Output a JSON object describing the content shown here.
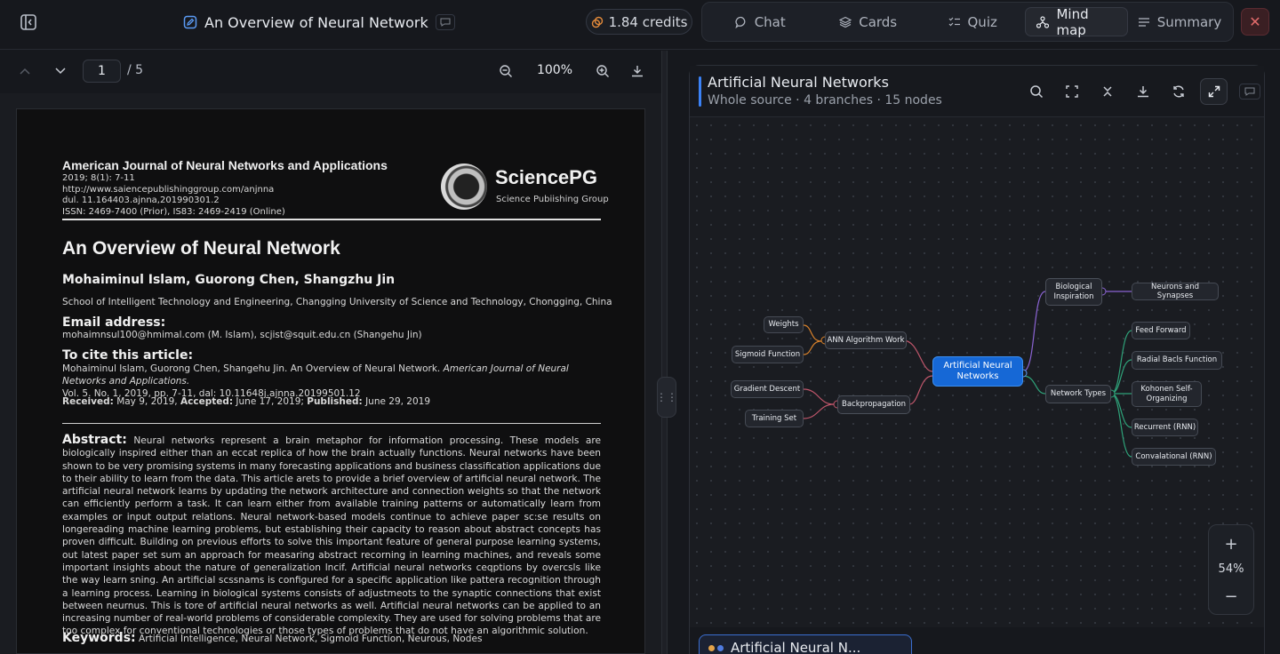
{
  "topbar": {
    "doc_title": "An Overview of Neural Network",
    "credits": "1.84 credits",
    "tabs": [
      {
        "label": "Chat",
        "icon": "chat-bubble-icon"
      },
      {
        "label": "Cards",
        "icon": "cards-stack-icon"
      },
      {
        "label": "Quiz",
        "icon": "quiz-list-icon"
      },
      {
        "label": "Mind map",
        "icon": "mind-map-icon",
        "active": true
      },
      {
        "label": "Summary",
        "icon": "summary-lines-icon"
      }
    ]
  },
  "pdf": {
    "current_page": "1",
    "page_total": "/ 5",
    "zoom": "100%",
    "journal": "American Journal of Neural Networks and Applications",
    "journal_meta": [
      "2019; 8(1): 7-11",
      "http://www.saiencepublishinggroup.com/anjnna",
      "dul. 11.164403.ajnna,201990301.2",
      "ISSN: 2469-7400 (Prior), IS83: 2469-2419 (Online)"
    ],
    "publisher": "SciencePG",
    "publisher_sub": "Science Pubiishing Group",
    "title": "An Overview of Neural Network",
    "authors": "Mohaiminul Islam, Guorong Chen, Shangzhu Jin",
    "affiliation": "School of Intelligent Technology and Engineering, Changging University of Science and Technology, Chongging, China",
    "email_heading": "Email address:",
    "email": "mohaimnsul100@hmimal.com (M. Islam), scjist@squit.edu.cn (Shangehu Jin)",
    "cite_heading": "To cite this article:",
    "cite_text": "Mohaiminul Islam, Guorong Chen, Shangehu Jin. An Overview of Neural Network.",
    "cite_journal": "American Journal of Neural Networks and Applications.",
    "cite_rest": "Vol. 5. No. 1, 2019, pp. 7-11, dal: 10.11648j.ajnna.20199501.12",
    "received_label": "Received:",
    "received": "May 9, 2019,",
    "accepted_label": "Accepted:",
    "accepted": "June 17, 2019;",
    "published_label": "Published:",
    "published": "June 29, 2019",
    "abstract_heading": "Abstract:",
    "abstract": "Neural networks represent a brain metaphor for information processing. These models are biologically inspired either than an eccat replica of how the brain actually functions. Neural networks have been shown to be very promising systems in many forecasting applications and business classification applications due to their ability to learn from the data. This article arets to provide a brief overview of artificial neural network. The artificial neural network learns by updating the network architecture and connection weights so that the network can efficiently perform a task. It can learn either from available training patterns or automatically learn from examples or input output relations. Neural network-based models continue to achieve paper sc:se results on longereading machine learning problems, but establishing their capacity to reason about abstract concepts has proven difficult. Building on previous efforts to solve this important feature of general purpose learning systems, out latest paper set sum an approach for measaring abstract recorning in learning machines, and reveals some important insights about the nature of generalization lncif. Artificial neural networks ceqptions by overcsls like the way learn sning. An artificial scssnams is configured for a specific application like pattera recognition through a learning process. Learning in biological systems consists of adjustmeots to the synaptic connections that exist between neurnus. This is tore of artificial neural networks as well. Artificial neural networks can be applied to an increasing number of real-world problems of considerable complexity. They are used for solving problems that are too complex for conventional technologies or those types of problems that do not have an algorithmic solution.",
    "keywords_heading": "Keywords:",
    "keywords": "Artificial Intelligence, Neural Network, Sigmoid Function, Neurous, Nodes"
  },
  "mindmap": {
    "title": "Artificial Neural Networks",
    "subtitle": "Whole source · 4 branches · 15 nodes",
    "zoom": "54%",
    "bottom_chip": "Artificial Neural N...",
    "root": "Artificial Neural Networks",
    "branches": {
      "ann": "ANN Algorithm Work",
      "backprop": "Backpropagation",
      "bio": "Biological Inspiration",
      "types": "Network Types"
    },
    "leaves": {
      "weights": "Weights",
      "sigmoid": "Sigmoid Function",
      "gradient": "Gradient Descent",
      "training": "Training Set",
      "neurons": "Neurons and Synapses",
      "feedforward": "Feed Forward",
      "rbf": "Radial Bacls Function",
      "kohonen": "Kohonen Self-Organizing",
      "recurrent": "Recurrent (RNN)",
      "conv": "Convalational (RNN)"
    },
    "colors": {
      "root": "#1668d6",
      "left_links": "#c0566b",
      "ann_links": "#d9822b",
      "bio_links": "#8a63d2",
      "types_links": "#2fa37a"
    }
  }
}
